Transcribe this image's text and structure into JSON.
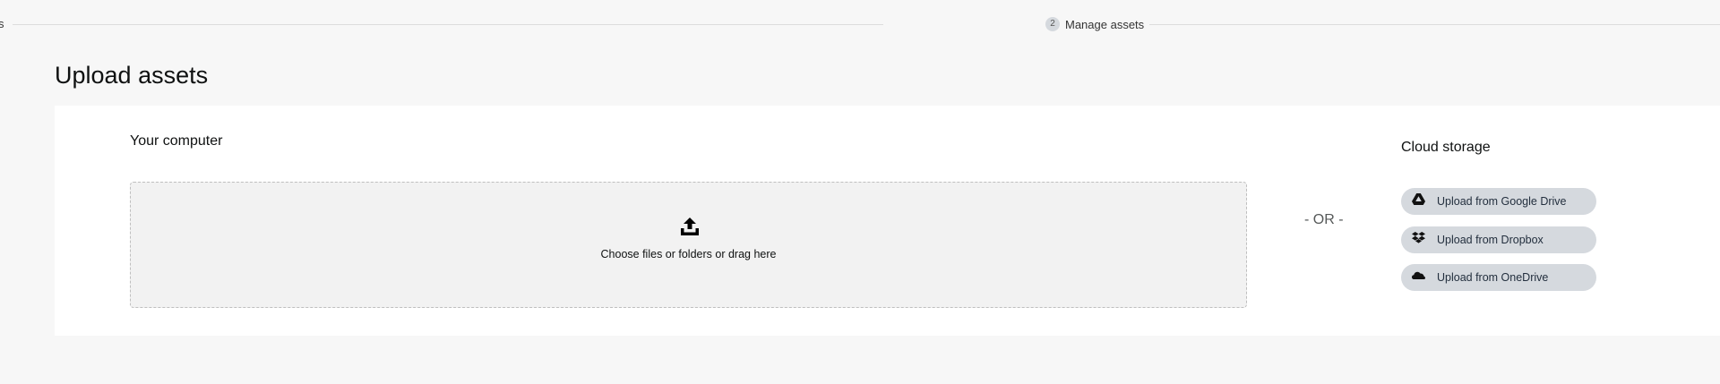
{
  "stepper": {
    "previous_step_label": "s",
    "current_step": {
      "number": "2",
      "label": "Manage assets"
    }
  },
  "page": {
    "title": "Upload assets"
  },
  "computer_section": {
    "title": "Your computer",
    "dropzone_label": "Choose files or folders or drag here",
    "icon": "upload-tray-icon"
  },
  "divider": {
    "label": "- OR -"
  },
  "cloud_section": {
    "title": "Cloud storage",
    "buttons": [
      {
        "label": "Upload from Google Drive",
        "icon": "google-drive-icon"
      },
      {
        "label": "Upload from Dropbox",
        "icon": "dropbox-icon"
      },
      {
        "label": "Upload from OneDrive",
        "icon": "onedrive-icon"
      }
    ]
  },
  "colors": {
    "page_background": "#f7f7f7",
    "panel_background": "#ffffff",
    "dropzone_background": "#f2f2f2",
    "cloud_button_background": "#d5d9de",
    "text": "#0f1111"
  }
}
